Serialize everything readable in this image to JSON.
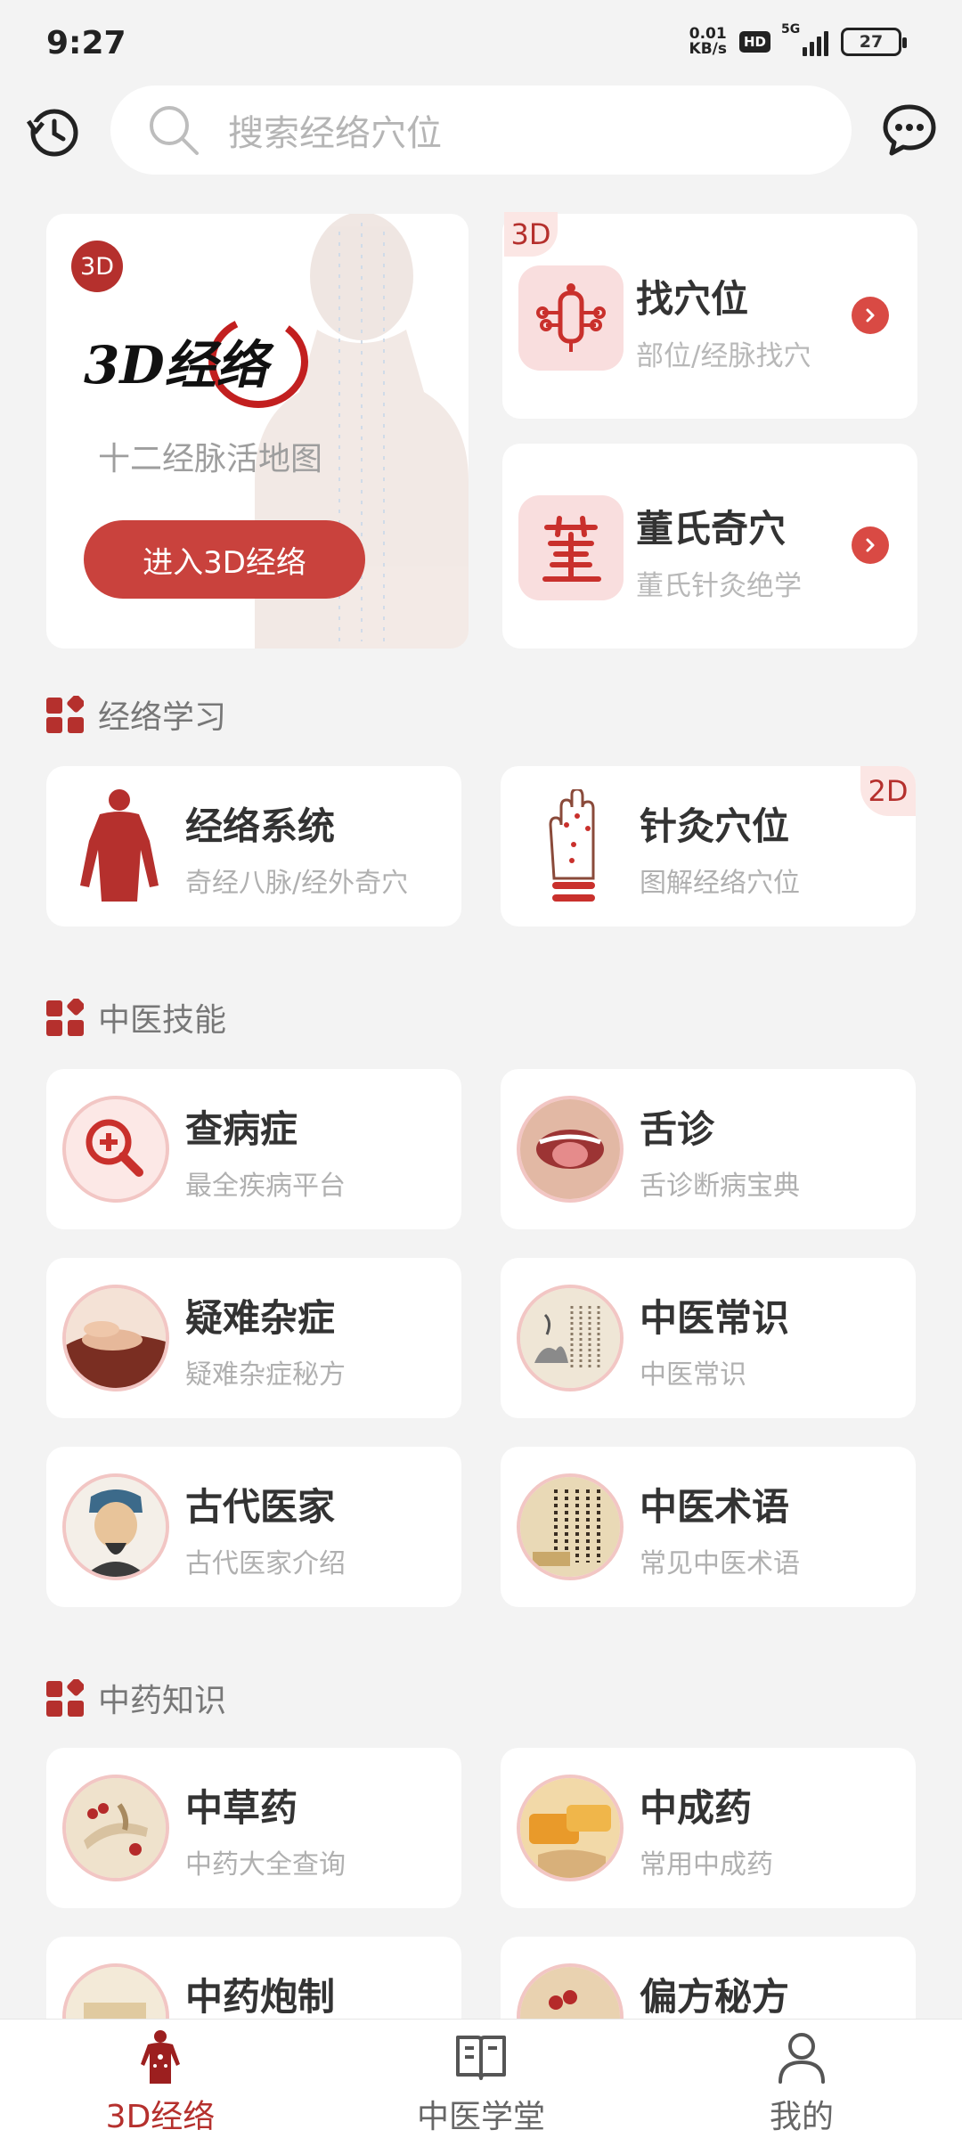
{
  "status_bar": {
    "time": "9:27",
    "net_speed_value": "0.01",
    "net_speed_unit": "KB/s",
    "hd": "HD",
    "signal": "5G",
    "battery": "27"
  },
  "header": {
    "search_placeholder": "搜索经络穴位"
  },
  "hero": {
    "badge": "3D",
    "logo_text": "3D经络",
    "subtitle": "十二经脉活地图",
    "button": "进入3D经络"
  },
  "features": [
    {
      "badge": "3D",
      "title": "找穴位",
      "subtitle": "部位/经脉找穴"
    },
    {
      "title": "董氏奇穴",
      "subtitle": "董氏针灸绝学"
    }
  ],
  "sections": {
    "learning": {
      "title": "经络学习",
      "items": [
        {
          "title": "经络系统",
          "subtitle": "奇经八脉/经外奇穴"
        },
        {
          "title": "针灸穴位",
          "subtitle": "图解经络穴位",
          "badge": "2D"
        }
      ]
    },
    "skills": {
      "title": "中医技能",
      "items": [
        {
          "title": "查病症",
          "subtitle": "最全疾病平台"
        },
        {
          "title": "舌诊",
          "subtitle": "舌诊断病宝典"
        },
        {
          "title": "疑难杂症",
          "subtitle": "疑难杂症秘方"
        },
        {
          "title": "中医常识",
          "subtitle": "中医常识"
        },
        {
          "title": "古代医家",
          "subtitle": "古代医家介绍"
        },
        {
          "title": "中医术语",
          "subtitle": "常见中医术语"
        }
      ]
    },
    "herbs": {
      "title": "中药知识",
      "items": [
        {
          "title": "中草药",
          "subtitle": "中药大全查询"
        },
        {
          "title": "中成药",
          "subtitle": "常用中成药"
        },
        {
          "title": "中药炮制",
          "subtitle": ""
        },
        {
          "title": "偏方秘方",
          "subtitle": ""
        }
      ]
    }
  },
  "bottom_nav": [
    {
      "label": "3D经络",
      "active": true
    },
    {
      "label": "中医学堂",
      "active": false
    },
    {
      "label": "我的",
      "active": false
    }
  ],
  "colors": {
    "accent": "#b5302d",
    "button": "#c9423d",
    "background": "#f3f3f3"
  }
}
